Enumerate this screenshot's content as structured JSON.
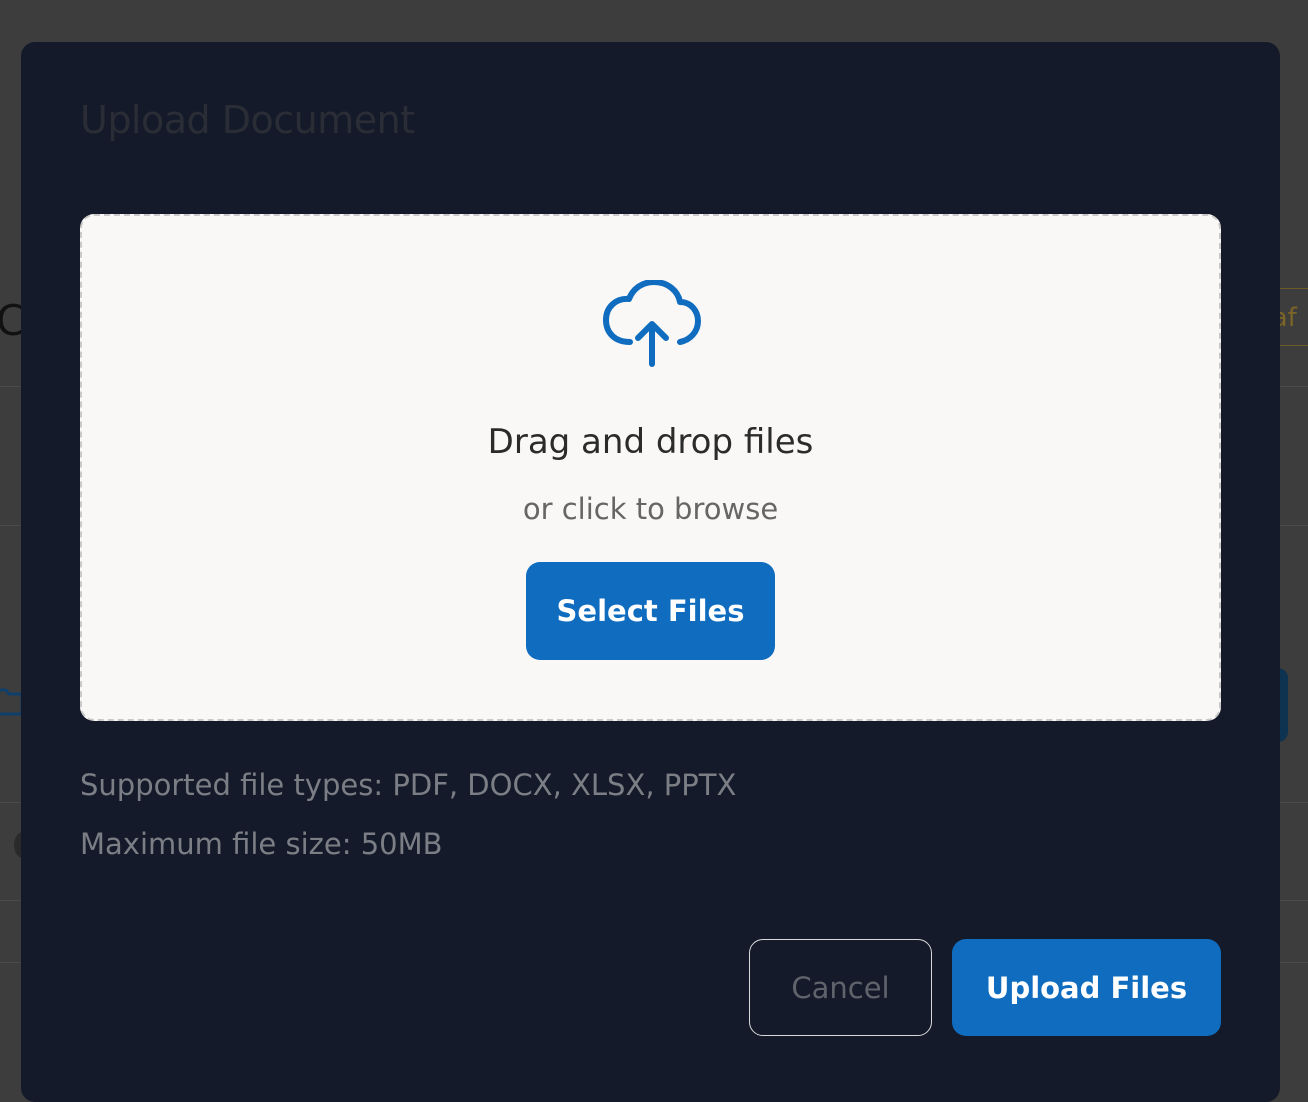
{
  "background": {
    "title_fragment": "C",
    "badge_fragment": "raf"
  },
  "modal": {
    "title": "Upload Document",
    "dropzone": {
      "icon": "cloud-upload-icon",
      "heading": "Drag and drop files",
      "subtext": "or click to browse",
      "select_button_label": "Select Files"
    },
    "supported_types": "Supported file types: PDF, DOCX, XLSX, PPTX",
    "max_size": "Maximum file size: 50MB",
    "cancel_label": "Cancel",
    "upload_label": "Upload Files"
  },
  "colors": {
    "accent": "#0f6cbf",
    "modal_bg": "#141a29",
    "dropzone_bg": "#f9f8f6"
  }
}
